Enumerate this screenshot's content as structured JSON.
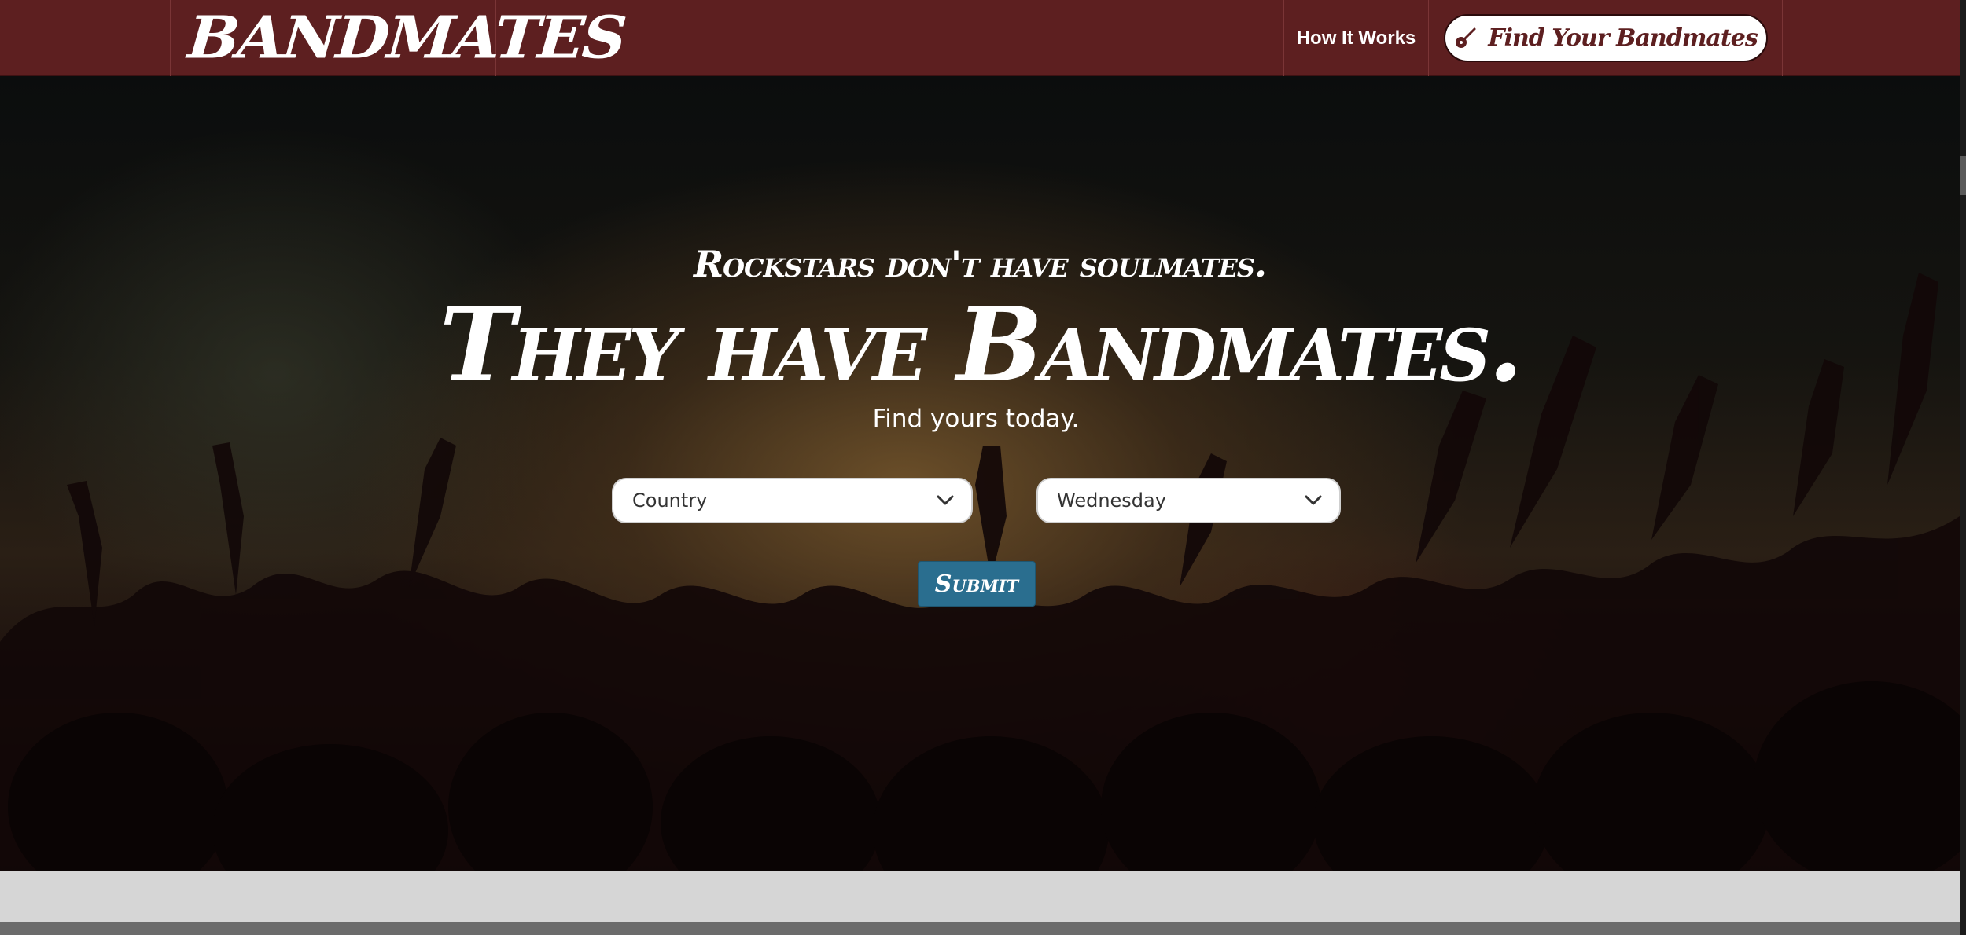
{
  "navbar": {
    "brand": "BANDMATES",
    "how_it_works": "How It Works",
    "cta_label": "Find Your Bandmates",
    "cta_icon": "guitar-icon"
  },
  "hero": {
    "tagline": "Rockstars don't have soulmates.",
    "headline": "They have Bandmates.",
    "subheading": "Find yours today.",
    "genre_select": {
      "value": "Country"
    },
    "day_select": {
      "value": "Wednesday"
    },
    "submit_label": "Submit"
  },
  "colors": {
    "navbar_bg": "#5d1f20",
    "submit_bg": "#2a6e8f",
    "page_bg": "#d6d6d6"
  }
}
